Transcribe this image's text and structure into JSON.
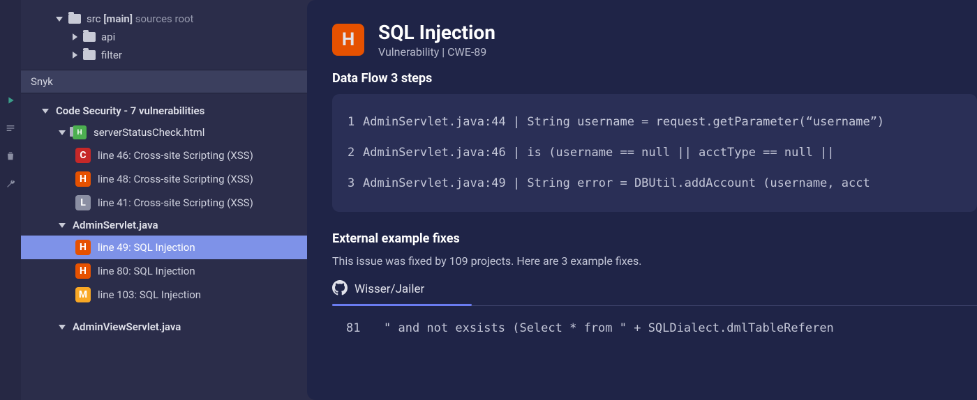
{
  "file_tree": {
    "root": {
      "name": "src",
      "branch": "[main]",
      "suffix": "sources root"
    },
    "children": [
      {
        "name": "api"
      },
      {
        "name": "filter"
      }
    ]
  },
  "panel_title": "Snyk",
  "code_security": {
    "group_label": "Code Security - 7 vulnerabilities",
    "files": [
      {
        "name": "serverStatusCheck.html",
        "issues": [
          {
            "sev": "C",
            "label": "line 46: Cross-site Scripting (XSS)"
          },
          {
            "sev": "H",
            "label": "line 48: Cross-site Scripting (XSS)"
          },
          {
            "sev": "L",
            "label": "line 41: Cross-site Scripting (XSS)"
          }
        ]
      },
      {
        "name": "AdminServlet.java",
        "plain": true,
        "issues": [
          {
            "sev": "H",
            "label": "line 49: SQL Injection",
            "selected": true
          },
          {
            "sev": "H",
            "label": "line 80: SQL Injection"
          },
          {
            "sev": "M",
            "label": "line 103: SQL Injection"
          }
        ]
      },
      {
        "name": "AdminViewServlet.java",
        "plain": true,
        "issues": []
      }
    ]
  },
  "detail": {
    "badge_sev": "H",
    "title": "SQL Injection",
    "subtitle": "Vulnerability | CWE-89",
    "flow_title": "Data Flow 3 steps",
    "flow": [
      {
        "n": "1",
        "loc": "AdminServlet.java:44",
        "code": "String username = request.getParameter(“username”)"
      },
      {
        "n": "2",
        "loc": "AdminServlet.java:46",
        "code": "is (username == null || acctType == null ||"
      },
      {
        "n": "3",
        "loc": "AdminServlet.java:49",
        "code": "String error = DBUtil.addAccount (username, acct"
      }
    ],
    "fixes_title": "External example fixes",
    "fixes_sub": "This issue was fixed by 109 projects. Here are 3 example fixes.",
    "fix_tab": "Wisser/Jailer",
    "code_line_num": "81",
    "code_line": "\" and not exsists (Select * from \" + SQLDialect.dmlTableReferen"
  }
}
